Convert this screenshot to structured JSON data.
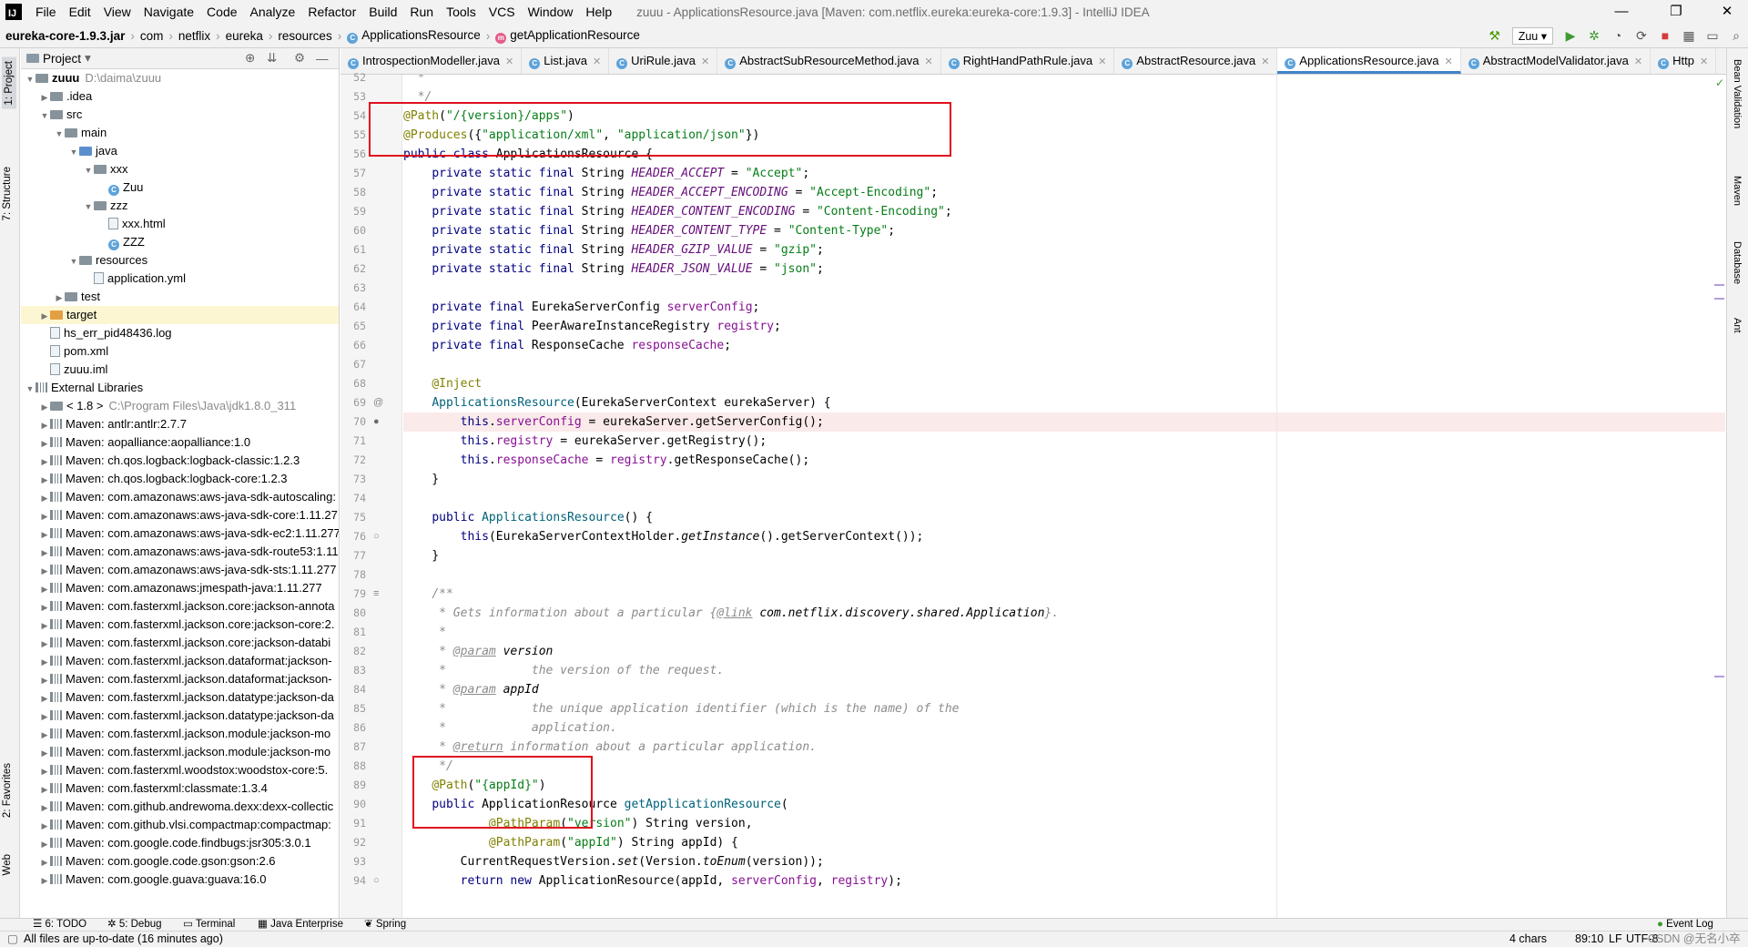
{
  "window": {
    "title": "zuuu - ApplicationsResource.java [Maven: com.netflix.eureka:eureka-core:1.9.3] - IntelliJ IDEA",
    "minimize": "—",
    "maximize": "❐",
    "close": "✕"
  },
  "menu": [
    "File",
    "Edit",
    "View",
    "Navigate",
    "Code",
    "Analyze",
    "Refactor",
    "Build",
    "Run",
    "Tools",
    "VCS",
    "Window",
    "Help"
  ],
  "breadcrumb": {
    "jar": "eureka-core-1.9.3.jar",
    "parts": [
      "com",
      "netflix",
      "eureka",
      "resources"
    ],
    "cls": "ApplicationsResource",
    "method": "getApplicationResource"
  },
  "run_config": "Zuu",
  "left_toolwindows": [
    "1: Project",
    "7: Structure",
    "2: Favorites",
    "Web"
  ],
  "right_toolwindows": [
    "Bean Validation",
    "Maven",
    "Database",
    "Ant"
  ],
  "project": {
    "header": "Project",
    "rows": [
      {
        "t": "zuuu",
        "g": "D:\\daima\\zuuu",
        "lvl": 0,
        "ic": "fold",
        "arr": "▼",
        "bold": true
      },
      {
        "t": ".idea",
        "lvl": 1,
        "ic": "fold",
        "arr": "▶"
      },
      {
        "t": "src",
        "lvl": 1,
        "ic": "fold",
        "arr": "▼"
      },
      {
        "t": "main",
        "lvl": 2,
        "ic": "fold",
        "arr": "▼"
      },
      {
        "t": "java",
        "lvl": 3,
        "ic": "fold b",
        "arr": "▼"
      },
      {
        "t": "xxx",
        "lvl": 4,
        "ic": "fold",
        "arr": "▼"
      },
      {
        "t": "Zuu",
        "lvl": 5,
        "ic": "cls",
        "arr": ""
      },
      {
        "t": "zzz",
        "lvl": 4,
        "ic": "fold",
        "arr": "▼"
      },
      {
        "t": "xxx.html",
        "lvl": 5,
        "ic": "file",
        "arr": ""
      },
      {
        "t": "ZZZ",
        "lvl": 5,
        "ic": "cls",
        "arr": ""
      },
      {
        "t": "resources",
        "lvl": 3,
        "ic": "fold",
        "arr": "▼"
      },
      {
        "t": "application.yml",
        "lvl": 4,
        "ic": "file",
        "arr": ""
      },
      {
        "t": "test",
        "lvl": 2,
        "ic": "fold",
        "arr": "▶"
      },
      {
        "t": "target",
        "lvl": 1,
        "ic": "fold o",
        "arr": "▶",
        "hl": true
      },
      {
        "t": "hs_err_pid48436.log",
        "lvl": 1,
        "ic": "file",
        "arr": ""
      },
      {
        "t": "pom.xml",
        "lvl": 1,
        "ic": "file",
        "arr": ""
      },
      {
        "t": "zuuu.iml",
        "lvl": 1,
        "ic": "file",
        "arr": ""
      },
      {
        "t": "External Libraries",
        "lvl": 0,
        "ic": "lib",
        "arr": "▼"
      },
      {
        "t": "< 1.8 >",
        "g": "C:\\Program Files\\Java\\jdk1.8.0_311",
        "lvl": 1,
        "ic": "fold",
        "arr": "▶"
      },
      {
        "t": "Maven: antlr:antlr:2.7.7",
        "lvl": 1,
        "ic": "lib",
        "arr": "▶"
      },
      {
        "t": "Maven: aopalliance:aopalliance:1.0",
        "lvl": 1,
        "ic": "lib",
        "arr": "▶"
      },
      {
        "t": "Maven: ch.qos.logback:logback-classic:1.2.3",
        "lvl": 1,
        "ic": "lib",
        "arr": "▶"
      },
      {
        "t": "Maven: ch.qos.logback:logback-core:1.2.3",
        "lvl": 1,
        "ic": "lib",
        "arr": "▶"
      },
      {
        "t": "Maven: com.amazonaws:aws-java-sdk-autoscaling:",
        "lvl": 1,
        "ic": "lib",
        "arr": "▶"
      },
      {
        "t": "Maven: com.amazonaws:aws-java-sdk-core:1.11.27",
        "lvl": 1,
        "ic": "lib",
        "arr": "▶"
      },
      {
        "t": "Maven: com.amazonaws:aws-java-sdk-ec2:1.11.277",
        "lvl": 1,
        "ic": "lib",
        "arr": "▶"
      },
      {
        "t": "Maven: com.amazonaws:aws-java-sdk-route53:1.11",
        "lvl": 1,
        "ic": "lib",
        "arr": "▶"
      },
      {
        "t": "Maven: com.amazonaws:aws-java-sdk-sts:1.11.277",
        "lvl": 1,
        "ic": "lib",
        "arr": "▶"
      },
      {
        "t": "Maven: com.amazonaws:jmespath-java:1.11.277",
        "lvl": 1,
        "ic": "lib",
        "arr": "▶"
      },
      {
        "t": "Maven: com.fasterxml.jackson.core:jackson-annota",
        "lvl": 1,
        "ic": "lib",
        "arr": "▶"
      },
      {
        "t": "Maven: com.fasterxml.jackson.core:jackson-core:2.",
        "lvl": 1,
        "ic": "lib",
        "arr": "▶"
      },
      {
        "t": "Maven: com.fasterxml.jackson.core:jackson-databi",
        "lvl": 1,
        "ic": "lib",
        "arr": "▶"
      },
      {
        "t": "Maven: com.fasterxml.jackson.dataformat:jackson-",
        "lvl": 1,
        "ic": "lib",
        "arr": "▶"
      },
      {
        "t": "Maven: com.fasterxml.jackson.dataformat:jackson-",
        "lvl": 1,
        "ic": "lib",
        "arr": "▶"
      },
      {
        "t": "Maven: com.fasterxml.jackson.datatype:jackson-da",
        "lvl": 1,
        "ic": "lib",
        "arr": "▶"
      },
      {
        "t": "Maven: com.fasterxml.jackson.datatype:jackson-da",
        "lvl": 1,
        "ic": "lib",
        "arr": "▶"
      },
      {
        "t": "Maven: com.fasterxml.jackson.module:jackson-mo",
        "lvl": 1,
        "ic": "lib",
        "arr": "▶"
      },
      {
        "t": "Maven: com.fasterxml.jackson.module:jackson-mo",
        "lvl": 1,
        "ic": "lib",
        "arr": "▶"
      },
      {
        "t": "Maven: com.fasterxml.woodstox:woodstox-core:5.",
        "lvl": 1,
        "ic": "lib",
        "arr": "▶"
      },
      {
        "t": "Maven: com.fasterxml:classmate:1.3.4",
        "lvl": 1,
        "ic": "lib",
        "arr": "▶"
      },
      {
        "t": "Maven: com.github.andrewoma.dexx:dexx-collectic",
        "lvl": 1,
        "ic": "lib",
        "arr": "▶"
      },
      {
        "t": "Maven: com.github.vlsi.compactmap:compactmap:",
        "lvl": 1,
        "ic": "lib",
        "arr": "▶"
      },
      {
        "t": "Maven: com.google.code.findbugs:jsr305:3.0.1",
        "lvl": 1,
        "ic": "lib",
        "arr": "▶"
      },
      {
        "t": "Maven: com.google.code.gson:gson:2.6",
        "lvl": 1,
        "ic": "lib",
        "arr": "▶"
      },
      {
        "t": "Maven: com.google.guava:guava:16.0",
        "lvl": 1,
        "ic": "lib",
        "arr": "▶"
      }
    ]
  },
  "tabs": [
    {
      "label": "IntrospectionModeller.java",
      "act": false
    },
    {
      "label": "List.java",
      "act": false
    },
    {
      "label": "UriRule.java",
      "act": false
    },
    {
      "label": "AbstractSubResourceMethod.java",
      "act": false
    },
    {
      "label": "RightHandPathRule.java",
      "act": false
    },
    {
      "label": "AbstractResource.java",
      "act": false
    },
    {
      "label": "ApplicationsResource.java",
      "act": true
    },
    {
      "label": "AbstractModelValidator.java",
      "act": false
    },
    {
      "label": "Http",
      "act": false
    }
  ],
  "code_lines": [
    {
      "n": "52",
      "h": "  <span class=\"cm\">*</span>"
    },
    {
      "n": "53",
      "h": "  <span class=\"cm\">*/</span>"
    },
    {
      "n": "54",
      "h": "<span class=\"an\">@Path</span>(<span class=\"st\">\"/{version}/apps\"</span>)"
    },
    {
      "n": "55",
      "h": "<span class=\"an\">@Produces</span>({<span class=\"st\">\"application/xml\"</span>, <span class=\"st\">\"application/json\"</span>})"
    },
    {
      "n": "56",
      "h": "<span class=\"kw\">public class</span> ApplicationsResource {"
    },
    {
      "n": "57",
      "h": "    <span class=\"kw\">private static final</span> String <span class=\"cst\">HEADER_ACCEPT</span> = <span class=\"st\">\"Accept\"</span>;"
    },
    {
      "n": "58",
      "h": "    <span class=\"kw\">private static final</span> String <span class=\"cst\">HEADER_ACCEPT_ENCODING</span> = <span class=\"st\">\"Accept-Encoding\"</span>;"
    },
    {
      "n": "59",
      "h": "    <span class=\"kw\">private static final</span> String <span class=\"cst\">HEADER_CONTENT_ENCODING</span> = <span class=\"st\">\"Content-Encoding\"</span>;"
    },
    {
      "n": "60",
      "h": "    <span class=\"kw\">private static final</span> String <span class=\"cst\">HEADER_CONTENT_TYPE</span> = <span class=\"st\">\"Content-Type\"</span>;"
    },
    {
      "n": "61",
      "h": "    <span class=\"kw\">private static final</span> String <span class=\"cst\">HEADER_GZIP_VALUE</span> = <span class=\"st\">\"gzip\"</span>;"
    },
    {
      "n": "62",
      "h": "    <span class=\"kw\">private static final</span> String <span class=\"cst\">HEADER_JSON_VALUE</span> = <span class=\"st\">\"json\"</span>;"
    },
    {
      "n": "63",
      "h": ""
    },
    {
      "n": "64",
      "h": "    <span class=\"kw\">private final</span> EurekaServerConfig <span class=\"fd\">serverConfig</span>;"
    },
    {
      "n": "65",
      "h": "    <span class=\"kw\">private final</span> PeerAwareInstanceRegistry <span class=\"fd\">registry</span>;"
    },
    {
      "n": "66",
      "h": "    <span class=\"kw\">private final</span> ResponseCache <span class=\"fd\">responseCache</span>;"
    },
    {
      "n": "67",
      "h": ""
    },
    {
      "n": "68",
      "h": "    <span class=\"an\">@Inject</span>"
    },
    {
      "n": "69",
      "h": "    <span class=\"mt\">ApplicationsResource</span>(EurekaServerContext eurekaServer) {"
    },
    {
      "n": "70",
      "h": "        <span class=\"kw\">this</span>.<span class=\"fd\">serverConfig</span> = eurekaServer.getServerConfig();",
      "hl": true
    },
    {
      "n": "71",
      "h": "        <span class=\"kw\">this</span>.<span class=\"fd\">registry</span> = eurekaServer.getRegistry();"
    },
    {
      "n": "72",
      "h": "        <span class=\"kw\">this</span>.<span class=\"fd\">responseCache</span> = <span class=\"fd\">registry</span>.getResponseCache();"
    },
    {
      "n": "73",
      "h": "    }"
    },
    {
      "n": "74",
      "h": ""
    },
    {
      "n": "75",
      "h": "    <span class=\"kw\">public</span> <span class=\"mt\">ApplicationsResource</span>() {"
    },
    {
      "n": "76",
      "h": "        <span class=\"kw\">this</span>(EurekaServerContextHolder.<span class=\"sm\">getInstance</span>().getServerContext());"
    },
    {
      "n": "77",
      "h": "    }"
    },
    {
      "n": "78",
      "h": ""
    },
    {
      "n": "79",
      "h": "    <span class=\"cm\">/**</span>"
    },
    {
      "n": "80",
      "h": "<span class=\"cm\">     * Gets information about a particular {</span><span class=\"tg\">@link</span> <span class=\"sm\">com.netflix.discovery.shared.Application</span><span class=\"cm\">}.</span>"
    },
    {
      "n": "81",
      "h": "<span class=\"cm\">     *</span>"
    },
    {
      "n": "82",
      "h": "<span class=\"cm\">     * </span><span class=\"tg\">@param</span> <span class=\"sm\">version</span>"
    },
    {
      "n": "83",
      "h": "<span class=\"cm\">     *            the version of the request.</span>"
    },
    {
      "n": "84",
      "h": "<span class=\"cm\">     * </span><span class=\"tg\">@param</span> <span class=\"sm\">appId</span>"
    },
    {
      "n": "85",
      "h": "<span class=\"cm\">     *            the unique application identifier (which is the name) of the</span>"
    },
    {
      "n": "86",
      "h": "<span class=\"cm\">     *            application.</span>"
    },
    {
      "n": "87",
      "h": "<span class=\"cm\">     * </span><span class=\"tg\">@return</span><span class=\"cm\"> information about a particular application.</span>"
    },
    {
      "n": "88",
      "h": "<span class=\"cm\">     */</span>"
    },
    {
      "n": "89",
      "h": "    <span class=\"an\">@Path</span>(<span class=\"st\">\"{appId}\"</span>)"
    },
    {
      "n": "90",
      "h": "    <span class=\"kw\">public</span> ApplicationResource <span class=\"mt\">getApplicationResource</span>("
    },
    {
      "n": "91",
      "h": "            <span class=\"an\">@PathParam</span>(<span class=\"st\">\"version\"</span>) String version,"
    },
    {
      "n": "92",
      "h": "            <span class=\"an\">@PathParam</span>(<span class=\"st\">\"appId\"</span>) String appId) {"
    },
    {
      "n": "93",
      "h": "        CurrentRequestVersion.<span class=\"sm\">set</span>(Version.<span class=\"sm\">toEnum</span>(version));"
    },
    {
      "n": "94",
      "h": "        <span class=\"kw\">return new</span> ApplicationResource(appId, <span class=\"fd\">serverConfig</span>, <span class=\"fd\">registry</span>);"
    }
  ],
  "bottom_tabs": [
    "6: TODO",
    "5: Debug",
    "Terminal",
    "Java Enterprise",
    "Spring"
  ],
  "event_log": "Event Log",
  "status": {
    "message": "All files are up-to-date (16 minutes ago)",
    "chars": "4 chars",
    "position": "89:10",
    "le": "LF",
    "enc": "UTF-8",
    "watermark": "CSDN @无名小卒"
  }
}
